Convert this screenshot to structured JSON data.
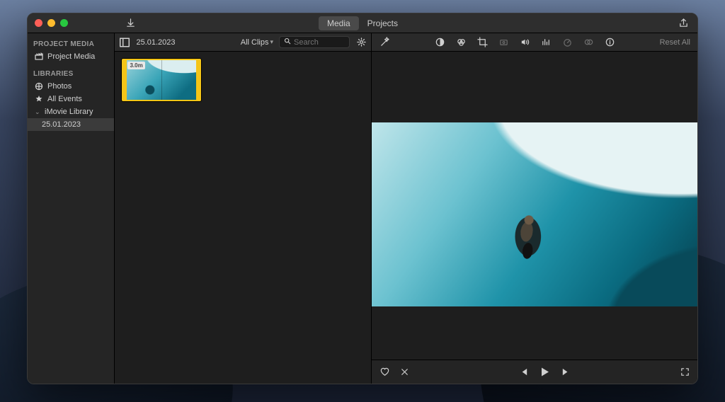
{
  "titlebar": {
    "tabs": {
      "media": "Media",
      "projects": "Projects"
    },
    "active_tab": "media"
  },
  "sidebar": {
    "headings": {
      "project_media": "PROJECT MEDIA",
      "libraries": "LIBRARIES"
    },
    "project_media_item": "Project Media",
    "photos_item": "Photos",
    "all_events_item": "All Events",
    "library_item": "iMovie Library",
    "event_item": "25.01.2023"
  },
  "browser": {
    "title": "25.01.2023",
    "filter_label": "All Clips",
    "search_placeholder": "Search",
    "clip": {
      "duration_badge": "3.0m"
    }
  },
  "viewer": {
    "reset_label": "Reset All"
  }
}
